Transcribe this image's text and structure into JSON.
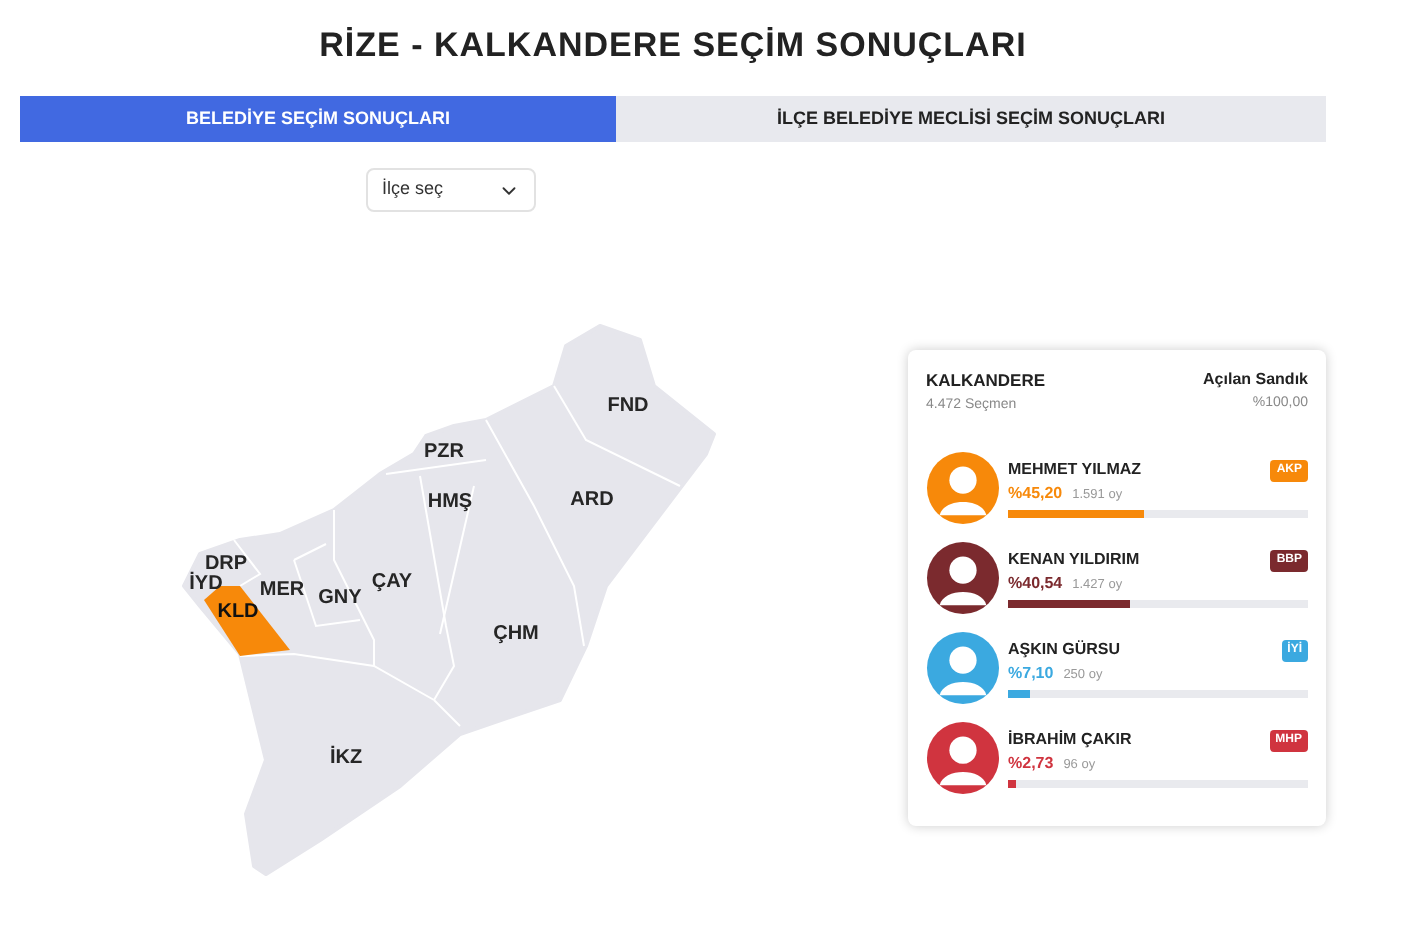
{
  "title": "RİZE - KALKANDERE SEÇİM SONUÇLARI",
  "tabs": [
    {
      "label": "BELEDİYE SEÇİM SONUÇLARI",
      "selected": true
    },
    {
      "label": "İLÇE BELEDİYE MECLİSİ SEÇİM SONUÇLARI",
      "selected": false
    }
  ],
  "district_select": {
    "value": "İlçe seç"
  },
  "map": {
    "districts": [
      {
        "code": "FND",
        "selected": false
      },
      {
        "code": "PZR",
        "selected": false
      },
      {
        "code": "HMŞ",
        "selected": false
      },
      {
        "code": "ARD",
        "selected": false
      },
      {
        "code": "DRP",
        "selected": false
      },
      {
        "code": "İYD",
        "selected": false
      },
      {
        "code": "MER",
        "selected": false
      },
      {
        "code": "KLD",
        "selected": true
      },
      {
        "code": "GNY",
        "selected": false
      },
      {
        "code": "ÇAY",
        "selected": false
      },
      {
        "code": "ÇHM",
        "selected": false
      },
      {
        "code": "İKZ",
        "selected": false
      }
    ]
  },
  "results": {
    "name": "KALKANDERE",
    "voters": "4.472 Seçmen",
    "opened_label": "Açılan Sandık",
    "opened_value": "%100,00",
    "candidates": [
      {
        "name": "MEHMET YILMAZ",
        "percent": "%45,20",
        "votes": "1.591 oy",
        "party": "AKP",
        "color": "#f7890a",
        "level": 0.452
      },
      {
        "name": "KENAN YILDIRIM",
        "percent": "%40,54",
        "votes": "1.427 oy",
        "party": "BBP",
        "color": "#7b2a2e",
        "level": 0.4054
      },
      {
        "name": "AŞKIN GÜRSU",
        "percent": "%7,10",
        "votes": "250 oy",
        "party": "İYİ",
        "color": "#3ba9e0",
        "level": 0.071
      },
      {
        "name": "İBRAHİM ÇAKIR",
        "percent": "%2,73",
        "votes": "96 oy",
        "party": "MHP",
        "color": "#d0343f",
        "level": 0.0273
      }
    ]
  }
}
